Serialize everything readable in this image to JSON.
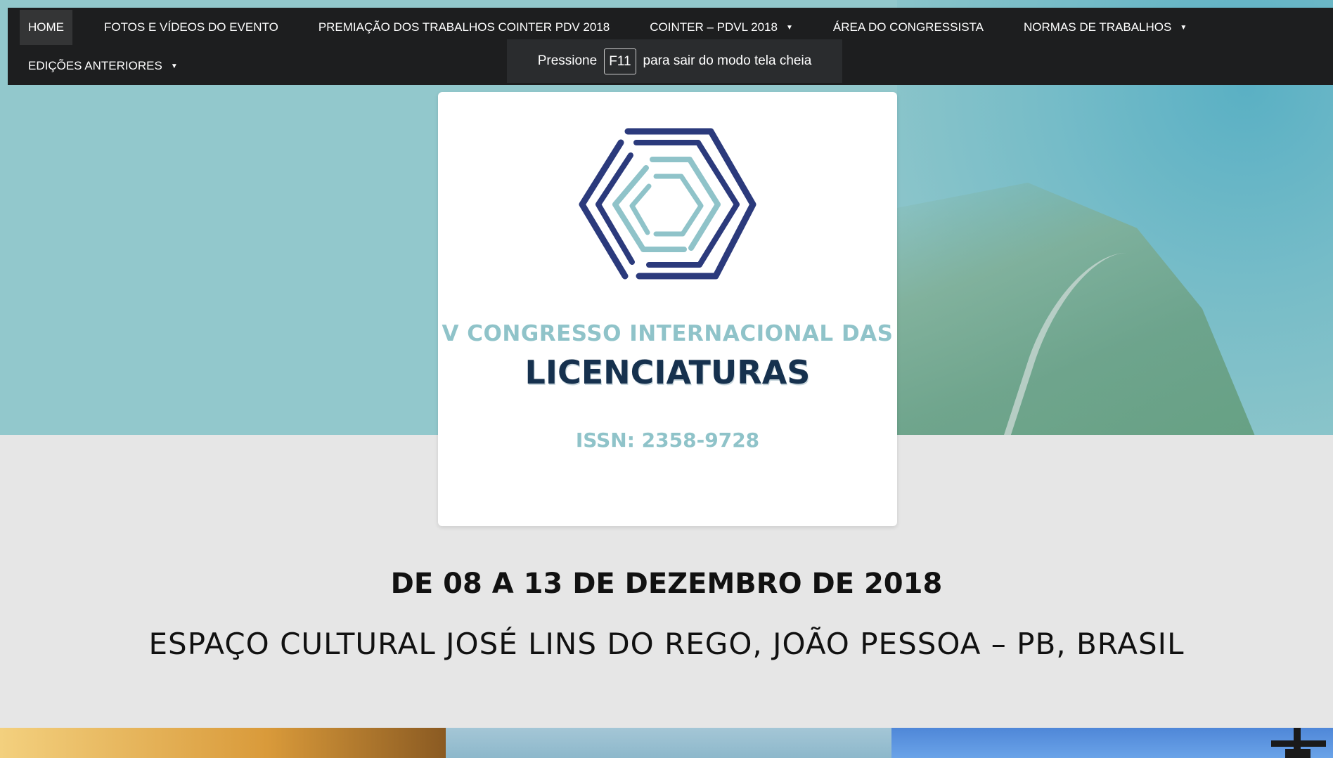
{
  "nav": {
    "items": [
      {
        "label": "HOME",
        "active": true,
        "dropdown": false
      },
      {
        "label": "FOTOS E VÍDEOS DO EVENTO",
        "dropdown": false
      },
      {
        "label": "PREMIAÇÃO DOS TRABALHOS COINTER PDV 2018",
        "dropdown": false
      },
      {
        "label": "COINTER – PDVL 2018",
        "dropdown": true
      },
      {
        "label": "ÁREA DO CONGRESSISTA",
        "dropdown": false
      },
      {
        "label": "NORMAS DE TRABALHOS",
        "dropdown": true
      },
      {
        "label": "EDIÇÕES ANTERIORES",
        "dropdown": true
      }
    ],
    "caret": "▼"
  },
  "fullscreen_tip": {
    "prefix": "Pressione",
    "key": "F11",
    "suffix": "para sair do modo tela cheia"
  },
  "logo_card": {
    "line1": "V CONGRESSO INTERNACIONAL DAS",
    "line2": "LICENCIATURAS",
    "issn": "ISSN: 2358-9728"
  },
  "event": {
    "date": "DE 08 A 13 DE DEZEMBRO DE 2018",
    "place": "ESPAÇO CULTURAL JOSÉ LINS DO REGO, JOÃO PESSOA – PB, BRASIL"
  },
  "colors": {
    "nav_bg": "#1d1e1f",
    "teal": "#8fc3c9",
    "navy": "#2b3a7c",
    "dark_title": "#16314e",
    "page_bg": "#e6e6e6"
  }
}
